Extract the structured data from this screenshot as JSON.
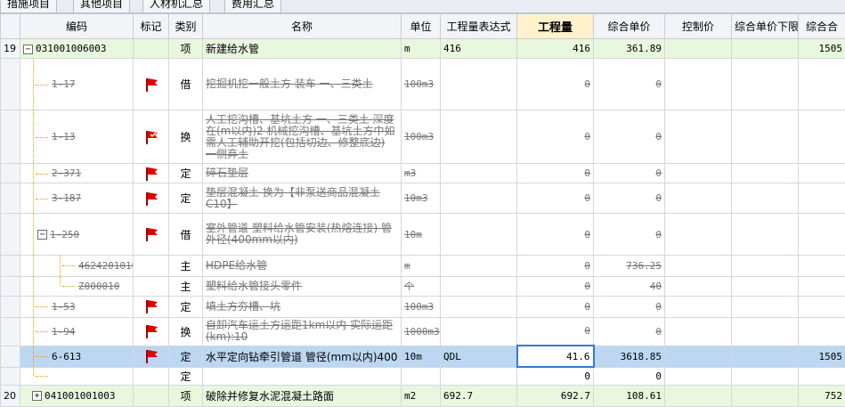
{
  "tabs": [
    "措施项目",
    "其他项目",
    "人材机汇总",
    "费用汇总"
  ],
  "headers": {
    "code": "编码",
    "mark": "标记",
    "type": "类别",
    "name": "名称",
    "unit": "单位",
    "expr": "工程量表达式",
    "qty": "工程量",
    "price": "综合单价",
    "control": "控制价",
    "price_low": "综合单价下限",
    "total": "综合合"
  },
  "rows": [
    {
      "rownum": "19",
      "code": "031001006003",
      "type": "项",
      "name": "新建给水管",
      "unit": "m",
      "expr": "416",
      "qty": "416",
      "price": "361.89",
      "total": "1505"
    },
    {
      "code": "1-17",
      "type": "借",
      "name": "挖掘机挖一般土方 装车 一、三类土",
      "unit": "100m3",
      "qty": "0",
      "price": "0"
    },
    {
      "code": "1-13",
      "type": "换",
      "name": "人工挖沟槽、基坑土方 一、三类土 深度在(m以内)2 机械挖沟槽、基坑土方中如需人工辅助开挖(包括切边、修整底边) 一侧弃土",
      "unit": "100m3",
      "qty": "0",
      "price": "0"
    },
    {
      "code": "2-371",
      "type": "定",
      "name": "碎石垫层",
      "unit": "m3",
      "qty": "0",
      "price": "0"
    },
    {
      "code": "3-187",
      "type": "定",
      "name": "垫层混凝土 换为【非泵送商品混凝土C10】",
      "unit": "10m3",
      "qty": "0",
      "price": "0"
    },
    {
      "code": "1-250",
      "type": "借",
      "name": "室外管道 塑料给水管安装(热熔连接) 管外径(400mm以内)",
      "unit": "10m",
      "qty": "0",
      "price": "0"
    },
    {
      "code": "46242010104",
      "type": "主",
      "name": "HDPE给水管",
      "unit": "m",
      "qty": "0",
      "price": "736.25"
    },
    {
      "code": "Z000010",
      "type": "主",
      "name": "塑料给水管接头零件",
      "unit": "个",
      "qty": "0",
      "price": "40"
    },
    {
      "code": "1-53",
      "type": "定",
      "name": "填土方夯槽、坑",
      "unit": "100m3",
      "qty": "0",
      "price": "0"
    },
    {
      "code": "1-94",
      "type": "换",
      "name": "自卸汽车运土方运距1km以内 实际运距(km):10",
      "unit": "1000m3",
      "qty": "0",
      "price": "0"
    },
    {
      "code": "6-613",
      "type": "定",
      "name": "水平定向钻牵引管道 管径(mm以内)400",
      "unit": "10m",
      "expr": "QDL",
      "qty": "41.6",
      "price": "3618.85",
      "total": "1505"
    },
    {
      "code": "",
      "type": "定",
      "name": "",
      "unit": "",
      "qty": "0",
      "price": "0"
    },
    {
      "rownum": "20",
      "code": "041001001003",
      "type": "项",
      "name": "破除并修复水泥混凝土路面",
      "unit": "m2",
      "expr": "692.7",
      "qty": "692.7",
      "price": "108.61",
      "total": "752"
    }
  ],
  "colors": {
    "flag": "#e00000",
    "selection": "#bcd7f2",
    "group_row": "#e9f7de",
    "focus": "#3478d6"
  }
}
